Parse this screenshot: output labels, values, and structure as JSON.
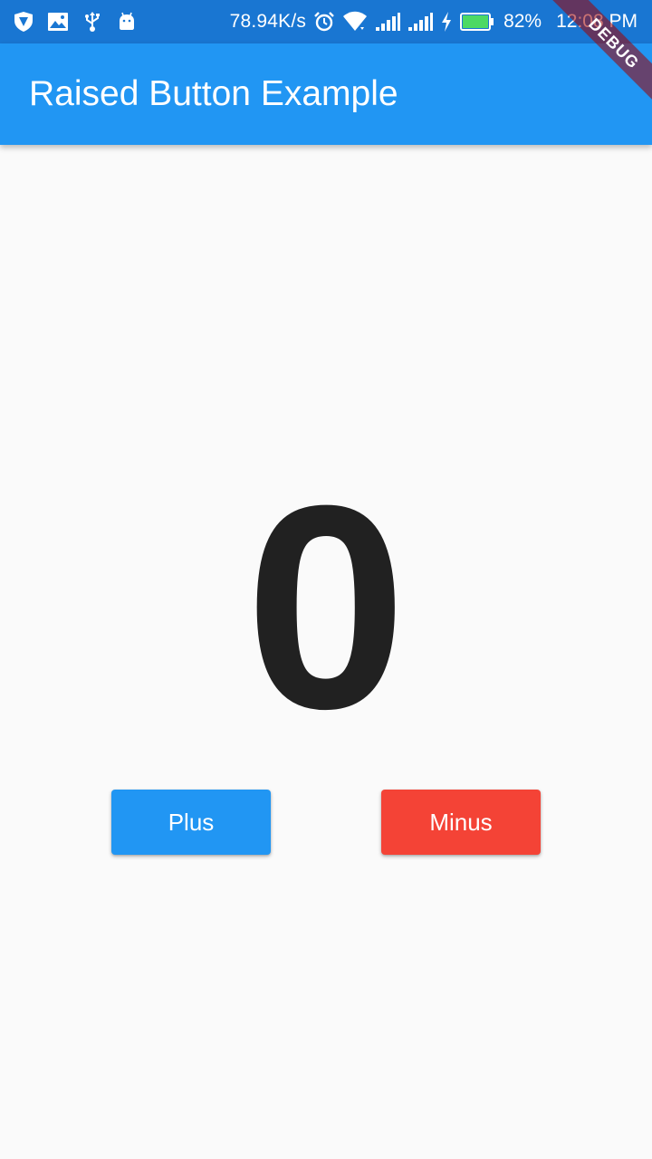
{
  "status_bar": {
    "network_speed": "78.94K/s",
    "battery_percent": "82%",
    "time": "12:08 PM",
    "left_icons": [
      "shield-icon",
      "image-icon",
      "usb-icon",
      "android-icon"
    ],
    "right_icons": [
      "alarm-icon",
      "wifi-icon",
      "signal-icon",
      "signal-icon",
      "charging-icon",
      "battery-icon"
    ]
  },
  "app_bar": {
    "title": "Raised Button Example"
  },
  "debug_banner": {
    "label": "DEBUG"
  },
  "counter": {
    "value": "0"
  },
  "buttons": {
    "plus_label": "Plus",
    "minus_label": "Minus"
  },
  "colors": {
    "status_bar": "#1976d2",
    "app_bar": "#2196f3",
    "plus_button": "#2196f3",
    "minus_button": "#f44336",
    "background": "#fafafa",
    "battery_fill": "#4cd964"
  }
}
